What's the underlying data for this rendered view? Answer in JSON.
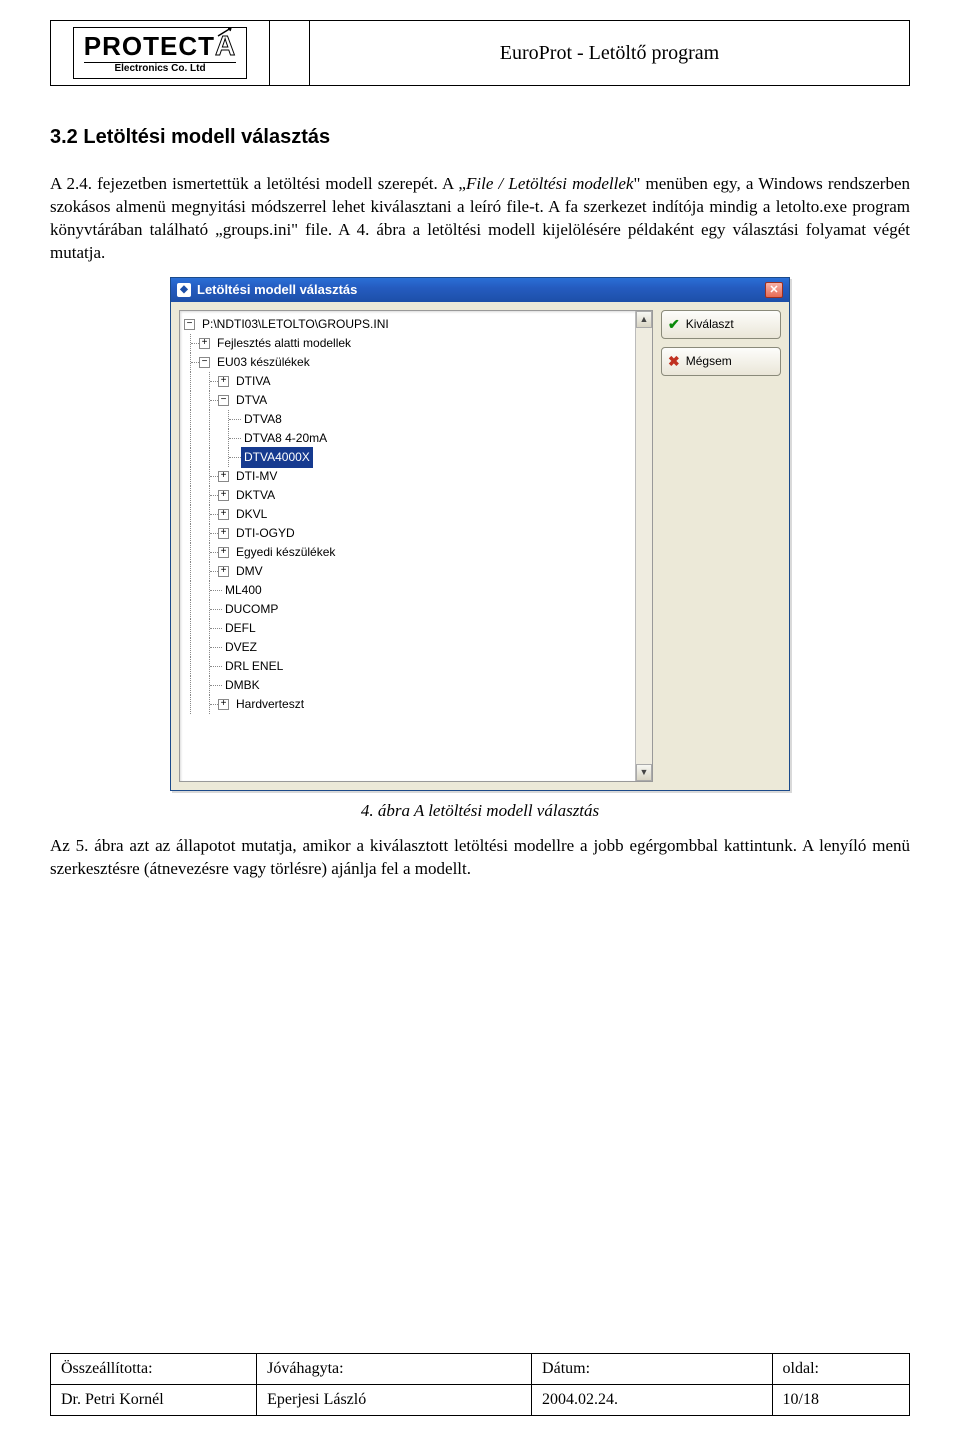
{
  "header": {
    "logo_main": "PROTECT",
    "logo_sub": "Electronics Co. Ltd",
    "title": "EuroProt - Letöltő program"
  },
  "section": {
    "heading": "3.2   Letöltési modell választás",
    "para1_a": "A 2.4. fejezetben ismertettük a letöltési modell szerepét. A „",
    "para1_b": "File / Letöltési modellek",
    "para1_c": "\" menüben egy, a Windows rendszerben szokásos almenü megnyitási módszerrel lehet kiválasztani a leíró file-t. A fa szerkezet indítója mindig a letolto.exe program könyvtárában található „groups.ini\" file. A 4. ábra a letöltési modell kijelölésére példaként egy választási folyamat végét mutatja."
  },
  "dialog": {
    "title": "Letöltési modell választás",
    "btn_select": "Kiválaszt",
    "btn_cancel": "Mégsem",
    "tree": {
      "root": "P:\\NDTI03\\LETOLTO\\GROUPS.INI",
      "n_fejl": "Fejlesztés alatti modellek",
      "n_eu03": "EU03 készülékek",
      "n_dtiva": "DTIVA",
      "n_dtva": "DTVA",
      "n_dtva8": "DTVA8",
      "n_dtva8_420": "DTVA8 4-20mA",
      "n_dtva4000x": "DTVA4000X",
      "n_dtimv": "DTI-MV",
      "n_dktva": "DKTVA",
      "n_dkvl": "DKVL",
      "n_dtiogyd": "DTI-OGYD",
      "n_egyedi": "Egyedi készülékek",
      "n_dmv": "DMV",
      "n_ml400": "ML400",
      "n_ducomp": "DUCOMP",
      "n_defl": "DEFL",
      "n_dvez": "DVEZ",
      "n_drlenel": "DRL ENEL",
      "n_dmbk": "DMBK",
      "n_hardver": "Hardverteszt"
    }
  },
  "caption": "4. ábra A letöltési modell választás",
  "para2": "Az 5. ábra azt az állapotot mutatja, amikor a kiválasztott letöltési modellre a jobb egérgombbal kattintunk. A lenyíló menü szerkesztésre (átnevezésre vagy törlésre) ajánlja fel a modellt.",
  "footer": {
    "h1": "Összeállította:",
    "h2": "Jóváhagyta:",
    "h3": "Dátum:",
    "h4": "oldal:",
    "v1": "Dr. Petri Kornél",
    "v2": "Eperjesi László",
    "v3": "2004.02.24.",
    "v4": "10/18"
  }
}
